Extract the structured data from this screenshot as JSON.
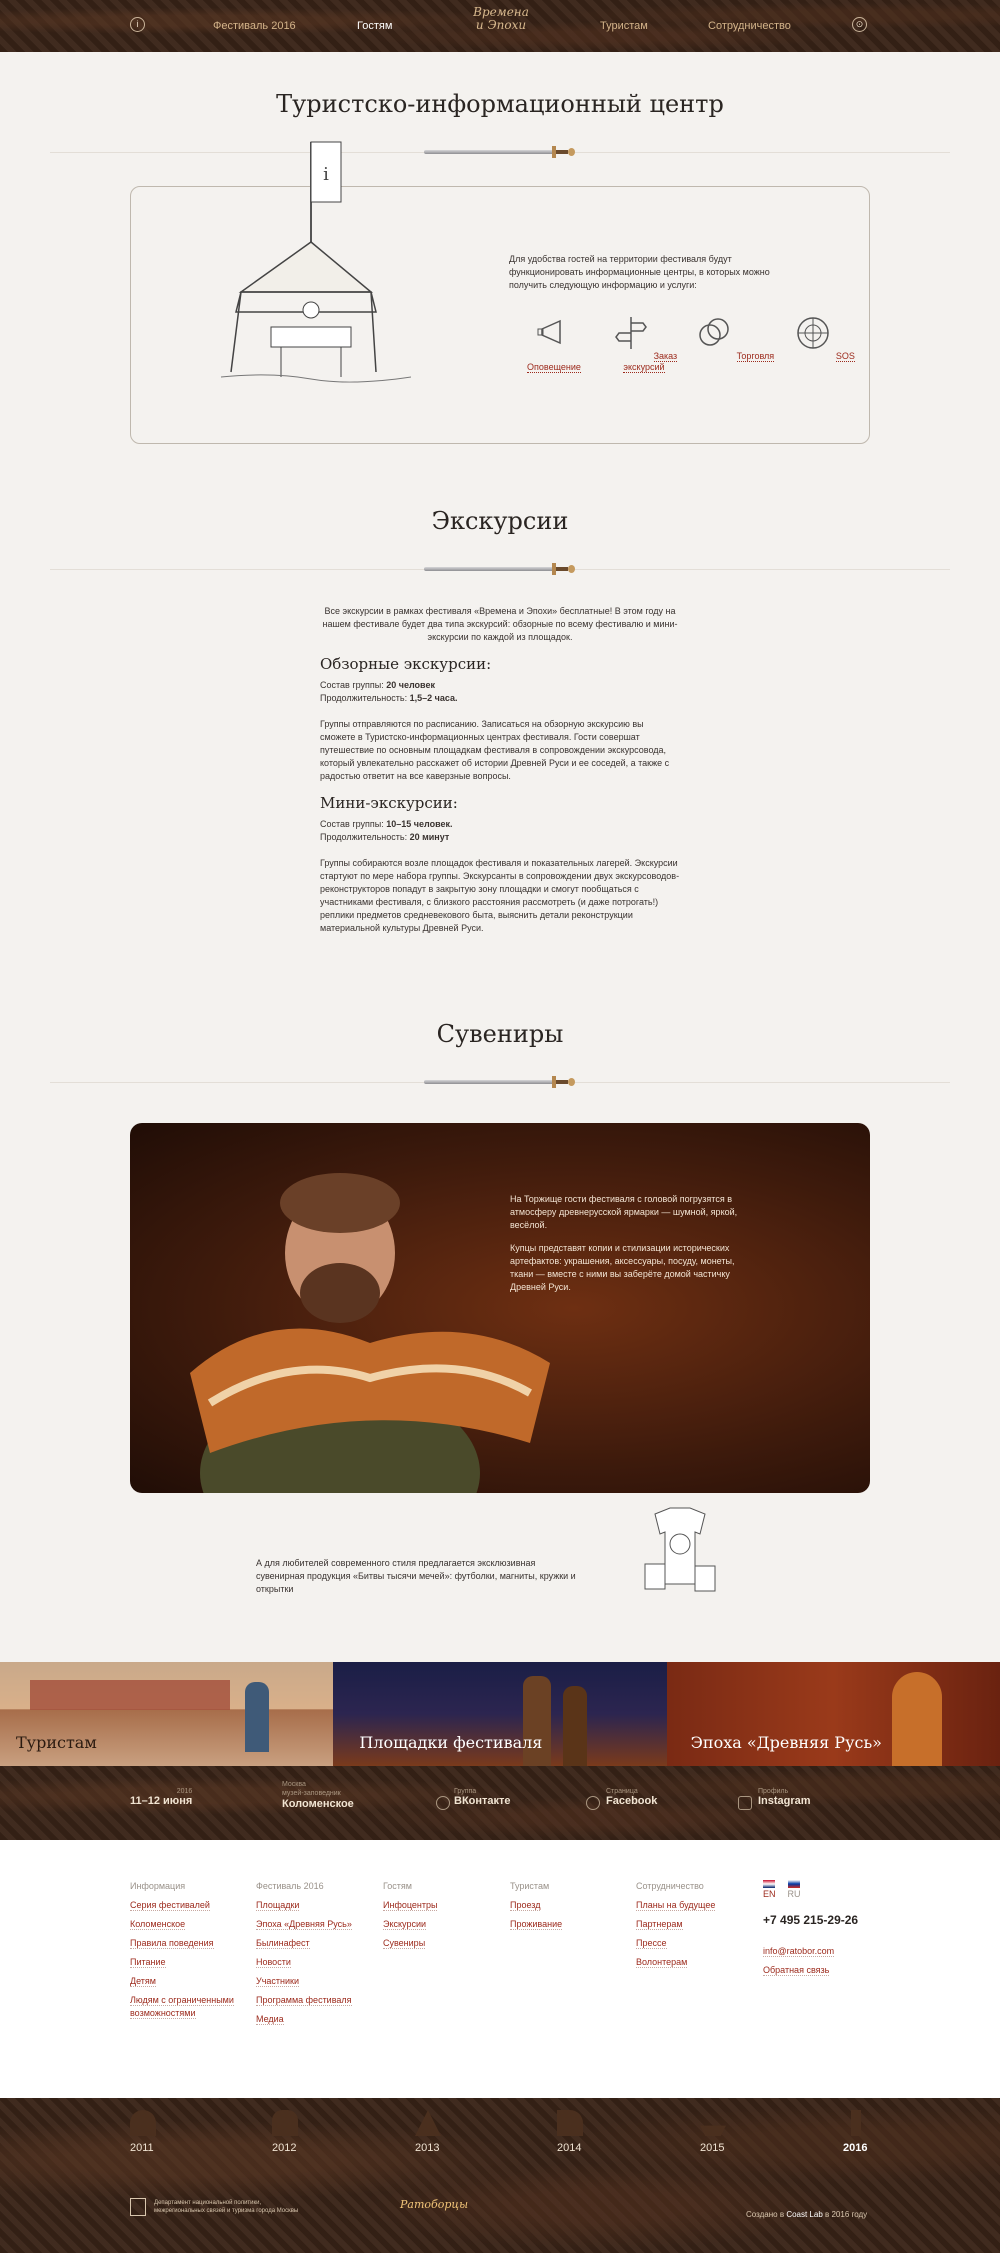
{
  "header": {
    "info_icon": "i",
    "nav": [
      "Фестиваль 2016",
      "Гостям",
      "Туристам",
      "Сотрудничество"
    ],
    "logo_lines": [
      "Времена",
      "и Эпохи"
    ],
    "cart_icon": "⊙"
  },
  "tic": {
    "title": "Туристско-информационный центр",
    "text": "Для удобства гостей на территории фестиваля будут функционировать информационные центры, в которых можно получить следующую информацию и услуги:",
    "services": [
      "Оповещение",
      "Заказ экскурсий",
      "Торговля",
      "SOS"
    ]
  },
  "excursions": {
    "title": "Экскурсии",
    "intro": "Все экскурсии в рамках фестиваля «Времена и Эпохи» бесплатные! В этом году на нашем фестивале будет два типа экскурсий: обзорные по всему фестивалю и мини-экскурсии по каждой из площадок.",
    "overview_title": "Обзорные экскурсии:",
    "overview_group_label": "Состав группы: ",
    "overview_group": "20 человек",
    "overview_duration_label": "Продолжительность: ",
    "overview_duration": "1,5–2 часа.",
    "overview_text": "Группы отправляются по расписанию. Записаться на обзорную экскурсию вы сможете в Туристско-информационных центрах фестиваля. Гости совершат путешествие по основным площадкам фестиваля в сопровождении экскурсовода, который увлекательно расскажет об истории Древней Руси и ее соседей, а также с радостью ответит на все каверзные вопросы.",
    "mini_title": "Мини-экскурсии:",
    "mini_group_label": "Состав группы: ",
    "mini_group": "10–15 человек.",
    "mini_duration_label": "Продолжительность: ",
    "mini_duration": "20 минут",
    "mini_text": "Группы собираются возле площадок фестиваля и показательных лагерей. Экскурсии стартуют по мере набора группы. Экскурсанты в сопровождении двух экскурсоводов-реконструкторов попадут в закрытую зону площадки и смогут пообщаться с участниками фестиваля, с близкого расстояния рассмотреть (и даже потрогать!) реплики предметов средневекового быта, выяснить детали реконструкции материальной культуры Древней Руси."
  },
  "souvenirs": {
    "title": "Сувениры",
    "photo_text_1": "На Торжище гости фестиваля с головой погрузятся в атмосферу древнерусской ярмарки — шумной, яркой, весёлой.",
    "photo_text_2": "Купцы представят копии и стилизации исторических артефактов: украшения, аксессуары, посуду, монеты, ткани — вместе с ними вы заберёте домой частичку Древней Руси.",
    "modern_text": "А для любителей современного стиля предлагается эксклюзивная сувенирная продукция «Битвы тысячи мечей»: футболки, магниты, кружки и открытки"
  },
  "banners": [
    "Туристам",
    "Площадки фестиваля",
    "Эпоха «Древняя Русь»"
  ],
  "strip": {
    "year_small": "2016",
    "dates": "11–12 июня",
    "place_small": "Москва\nмузей-заповедник",
    "place": "Коломенское",
    "vk_small": "Группа",
    "vk": "ВКонтакте",
    "fb_small": "Страница",
    "fb": "Facebook",
    "ig_small": "Профиль",
    "ig": "Instagram"
  },
  "footer_menu": {
    "col1_head": "Информация",
    "col1": [
      "Серия фестивалей",
      "Коломенское",
      "Правила поведения",
      "Питание",
      "Детям",
      "Людям с ограниченными возможностями"
    ],
    "col2_head": "Фестиваль 2016",
    "col2": [
      "Площадки",
      "Эпоха «Древняя Русь»",
      "Былинафест",
      "Новости",
      "Участники",
      "Программа фестиваля",
      "Медиа"
    ],
    "col3_head": "Гостям",
    "col3": [
      "Инфоцентры",
      "Экскурсии",
      "Сувениры"
    ],
    "col4_head": "Туристам",
    "col4": [
      "Проезд",
      "Проживание"
    ],
    "col5_head": "Сотрудничество",
    "col5": [
      "Планы на будущее",
      "Партнерам",
      "Прессе",
      "Волонтерам"
    ],
    "lang_en": "EN",
    "lang_ru": "RU",
    "phone": "+7 495 215-29-26",
    "email": "info@ratobor.com",
    "feedback": "Обратная связь"
  },
  "timeline": {
    "years": [
      "2011",
      "2012",
      "2013",
      "2014",
      "2015",
      "2016"
    ],
    "dept": "Департамент национальной политики, межрегиональных связей и туризма города Москвы",
    "brand": "Ратоборцы",
    "credit_pre": "Создано в ",
    "credit_brand": "Coast Lab",
    "credit_post": " в 2016 году"
  },
  "colors": {
    "accent": "#9c2a1c",
    "wood": "#3a2418",
    "bg": "#f4f2ef"
  }
}
